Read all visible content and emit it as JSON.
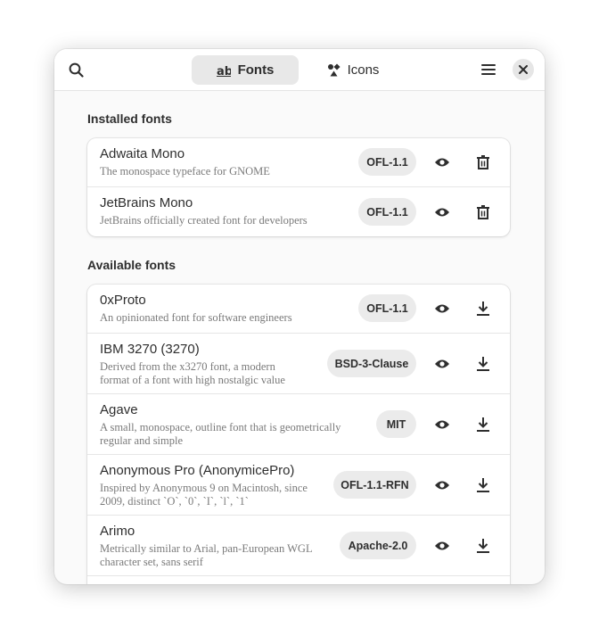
{
  "header": {
    "search_icon": "search-icon",
    "tabs": [
      {
        "label": "Fonts",
        "icon": "fonts-icon",
        "active": true
      },
      {
        "label": "Icons",
        "icon": "icons-icon",
        "active": false
      }
    ],
    "menu_icon": "hamburger-menu-icon",
    "close_icon": "close-icon"
  },
  "installed": {
    "title": "Installed fonts",
    "items": [
      {
        "name": "Adwaita Mono",
        "description": "The monospace typeface for GNOME",
        "license": "OFL-1.1",
        "actions": [
          "preview-icon",
          "trash-icon"
        ]
      },
      {
        "name": "JetBrains Mono",
        "description": "JetBrains officially created font for developers",
        "license": "OFL-1.1",
        "actions": [
          "preview-icon",
          "trash-icon"
        ]
      }
    ]
  },
  "available": {
    "title": "Available fonts",
    "items": [
      {
        "name": "0xProto",
        "description": "An opinionated font for software engineers",
        "license": "OFL-1.1",
        "actions": [
          "preview-icon",
          "download-icon"
        ]
      },
      {
        "name": "IBM 3270 (3270)",
        "description_lines": [
          "Derived from the x3270 font, a modern",
          "format of a font with high nostalgic value"
        ],
        "license": "BSD-3-Clause",
        "actions": [
          "preview-icon",
          "download-icon"
        ]
      },
      {
        "name": "Agave",
        "description_lines": [
          "A small, monospace, outline font that is geometrically",
          "regular and simple"
        ],
        "license": "MIT",
        "actions": [
          "preview-icon",
          "download-icon"
        ]
      },
      {
        "name": "Anonymous Pro (AnonymicePro)",
        "description_lines": [
          "Inspired by Anonymous 9 on Macintosh, since",
          "2009, distinct `O`, `0`, `I`, `l`, `1`"
        ],
        "license": "OFL-1.1-RFN",
        "actions": [
          "preview-icon",
          "download-icon"
        ]
      },
      {
        "name": "Arimo",
        "description_lines": [
          "Metrically similar to Arial, pan-European WGL",
          "character set, sans serif"
        ],
        "license": "Apache-2.0",
        "actions": [
          "preview-icon",
          "download-icon"
        ]
      }
    ]
  },
  "colors": {
    "window_bg": "#fafafa",
    "card_bg": "#ffffff",
    "pill_bg": "#ebebeb",
    "active_tab_bg": "#e8e8e8",
    "text": "#2e2e2e",
    "subtext": "#7a7a7a"
  }
}
